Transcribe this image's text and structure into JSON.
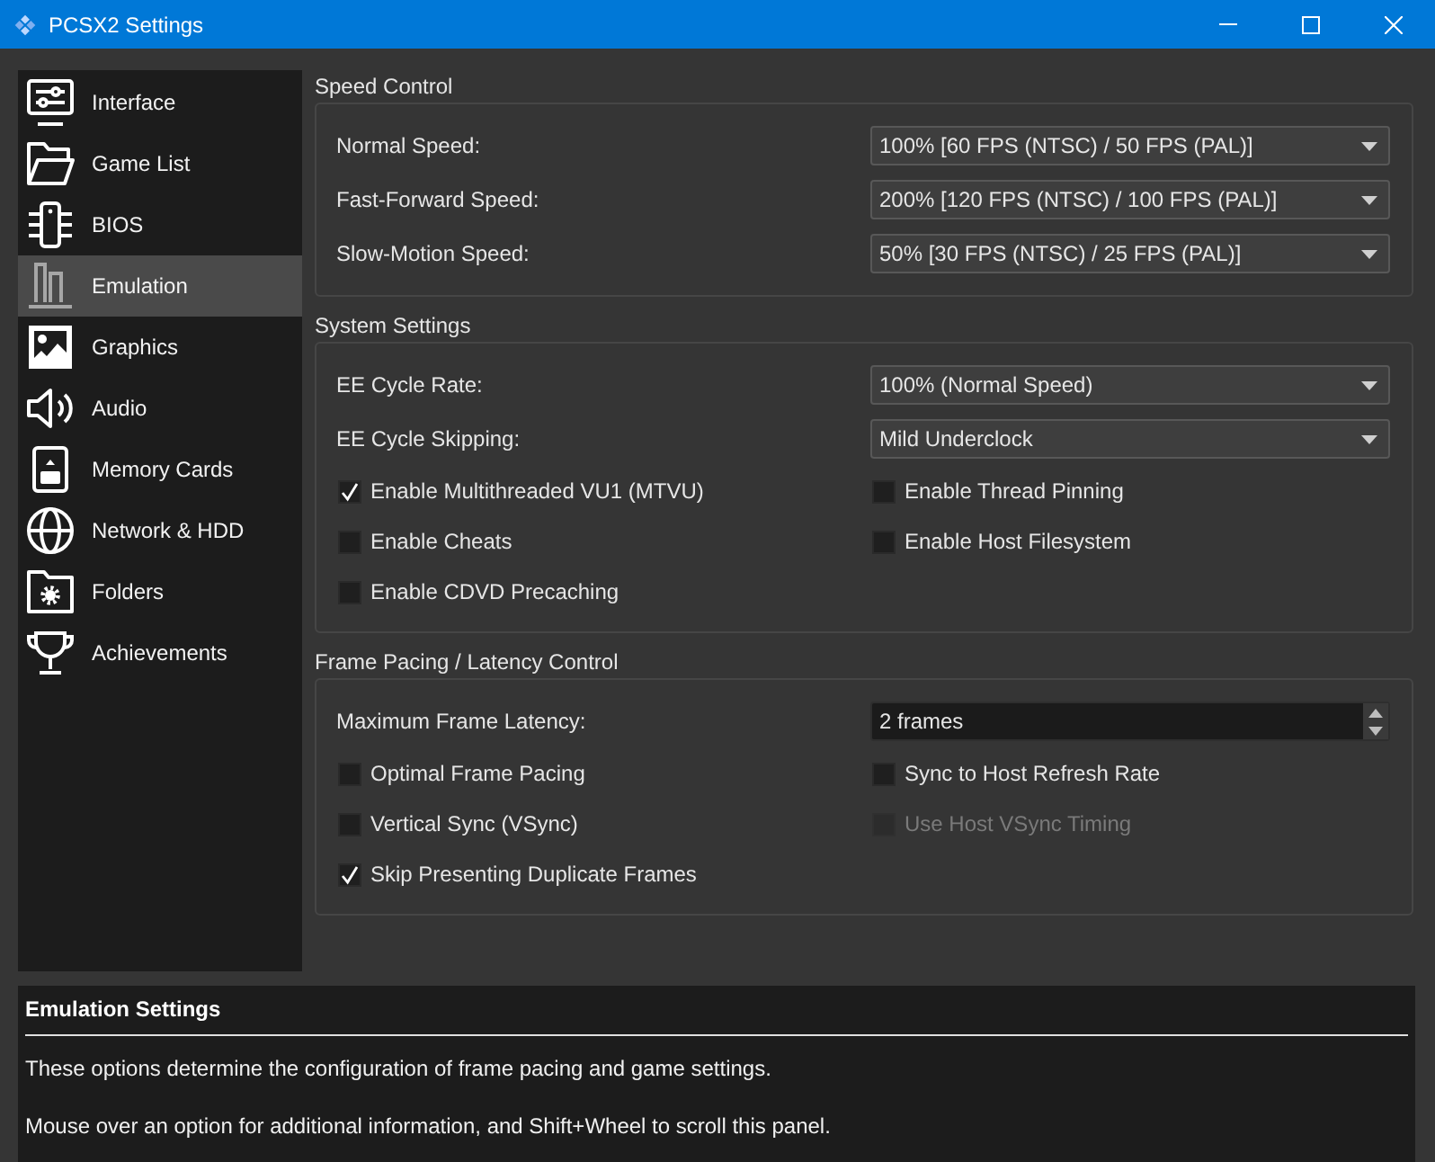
{
  "window": {
    "title": "PCSX2 Settings"
  },
  "sidebar": {
    "items": [
      {
        "label": "Interface",
        "selected": false
      },
      {
        "label": "Game List",
        "selected": false
      },
      {
        "label": "BIOS",
        "selected": false
      },
      {
        "label": "Emulation",
        "selected": true
      },
      {
        "label": "Graphics",
        "selected": false
      },
      {
        "label": "Audio",
        "selected": false
      },
      {
        "label": "Memory Cards",
        "selected": false
      },
      {
        "label": "Network & HDD",
        "selected": false
      },
      {
        "label": "Folders",
        "selected": false
      },
      {
        "label": "Achievements",
        "selected": false
      }
    ]
  },
  "groups": [
    {
      "title": "Speed Control",
      "rows": [
        {
          "kind": "combo",
          "label": "Normal Speed:",
          "value": "100% [60 FPS (NTSC) / 50 FPS (PAL)]"
        },
        {
          "kind": "combo",
          "label": "Fast-Forward Speed:",
          "value": "200% [120 FPS (NTSC) / 100 FPS (PAL)]"
        },
        {
          "kind": "combo",
          "label": "Slow-Motion Speed:",
          "value": "50% [30 FPS (NTSC) / 25 FPS (PAL)]"
        }
      ]
    },
    {
      "title": "System Settings",
      "rows": [
        {
          "kind": "combo",
          "label": "EE Cycle Rate:",
          "value": "100% (Normal Speed)"
        },
        {
          "kind": "combo",
          "label": "EE Cycle Skipping:",
          "value": "Mild Underclock"
        },
        {
          "kind": "checks",
          "items": [
            {
              "label": "Enable Multithreaded VU1 (MTVU)",
              "checked": true,
              "disabled": false
            },
            {
              "label": "Enable Thread Pinning",
              "checked": false,
              "disabled": false
            }
          ]
        },
        {
          "kind": "checks",
          "items": [
            {
              "label": "Enable Cheats",
              "checked": false,
              "disabled": false
            },
            {
              "label": "Enable Host Filesystem",
              "checked": false,
              "disabled": false
            }
          ]
        },
        {
          "kind": "checks",
          "items": [
            {
              "label": "Enable CDVD Precaching",
              "checked": false,
              "disabled": false
            }
          ]
        }
      ]
    },
    {
      "title": "Frame Pacing / Latency Control",
      "rows": [
        {
          "kind": "spin",
          "label": "Maximum Frame Latency:",
          "value": "2 frames"
        },
        {
          "kind": "checks",
          "items": [
            {
              "label": "Optimal Frame Pacing",
              "checked": false,
              "disabled": false
            },
            {
              "label": "Sync to Host Refresh Rate",
              "checked": false,
              "disabled": false
            }
          ]
        },
        {
          "kind": "checks",
          "items": [
            {
              "label": "Vertical Sync (VSync)",
              "checked": false,
              "disabled": false
            },
            {
              "label": "Use Host VSync Timing",
              "checked": false,
              "disabled": true
            }
          ]
        },
        {
          "kind": "checks",
          "items": [
            {
              "label": "Skip Presenting Duplicate Frames",
              "checked": true,
              "disabled": false
            }
          ]
        }
      ]
    }
  ],
  "help": {
    "title": "Emulation Settings",
    "paragraphs": [
      "These options determine the configuration of frame pacing and game settings.",
      "Mouse over an option for additional information, and Shift+Wheel to scroll this panel."
    ]
  }
}
